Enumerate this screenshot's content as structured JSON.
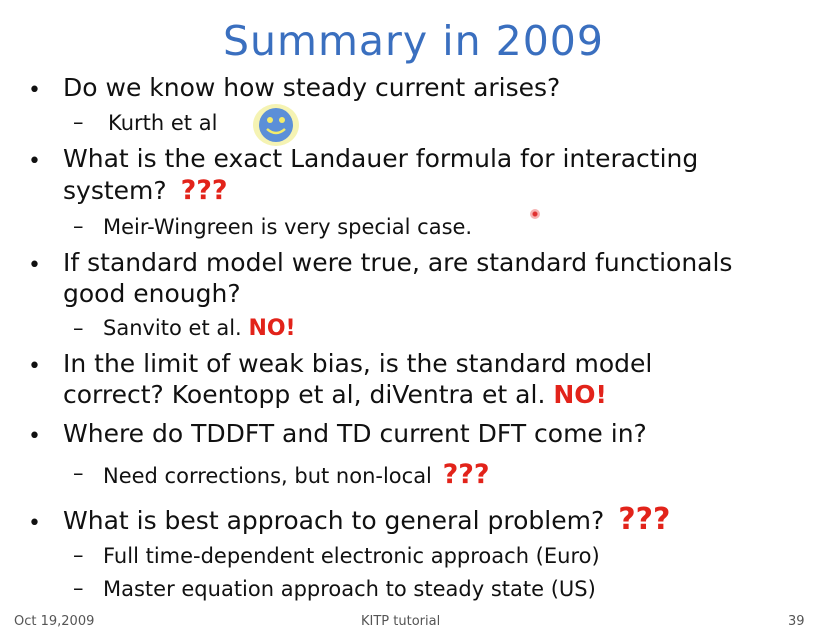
{
  "slide": {
    "title": "Summary in 2009",
    "items": [
      {
        "line1": "Do we know how steady current arises?"
      },
      {
        "sub": "Kurth et al"
      },
      {
        "line1": "What is the exact Landauer formula for interacting",
        "line2": "system?",
        "mark": "???"
      },
      {
        "sub": "Meir-Wingreen is very special case."
      },
      {
        "line1": "If standard model were true, are standard functionals",
        "line2": "good enough?"
      },
      {
        "sub": "Sanvito et al.",
        "mark": "NO!"
      },
      {
        "line1": "In the limit of weak bias, is the standard model",
        "line2": "correct?  Koentopp et al, diVentra et al.",
        "mark": "NO!"
      },
      {
        "line1": "Where do TDDFT and TD current DFT come in?"
      },
      {
        "sub": "Need corrections, but non-local",
        "mark": "???"
      },
      {
        "line1": "What is best approach to general problem?",
        "mark": "???"
      },
      {
        "sub": "Full time-dependent electronic approach (Euro)"
      },
      {
        "sub": "Master equation approach to steady state (US)"
      }
    ]
  },
  "footer": {
    "date": "Oct 19,2009",
    "center": "KITP tutorial",
    "page": "39"
  },
  "colors": {
    "title": "#3a6fbf",
    "accent": "#e2231a",
    "smiley": "#5b8fd8"
  },
  "icons": [
    "smiley-face-icon",
    "laser-pointer-dot"
  ]
}
